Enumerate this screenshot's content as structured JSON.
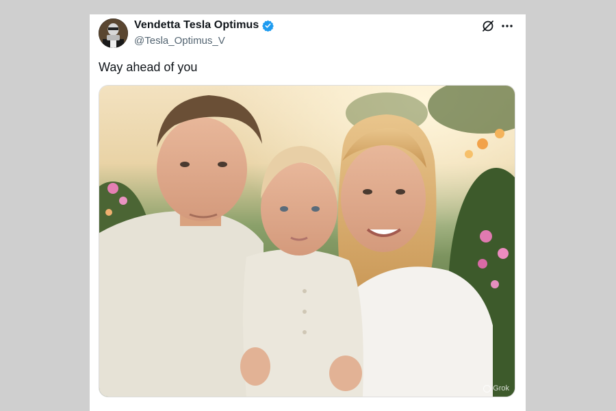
{
  "post": {
    "author": {
      "display_name": "Vendetta Tesla Optimus",
      "handle": "@Tesla_Optimus_V",
      "verified": true,
      "avatar_icon": "robot-avatar"
    },
    "text": "Way ahead of you",
    "actions": {
      "grok_icon": "grok-icon",
      "more_icon": "more-icon"
    },
    "media": {
      "watermark": "Grok"
    }
  },
  "colors": {
    "verified_badge": "#1d9bf0",
    "handle": "#536471",
    "text": "#0f1419"
  }
}
